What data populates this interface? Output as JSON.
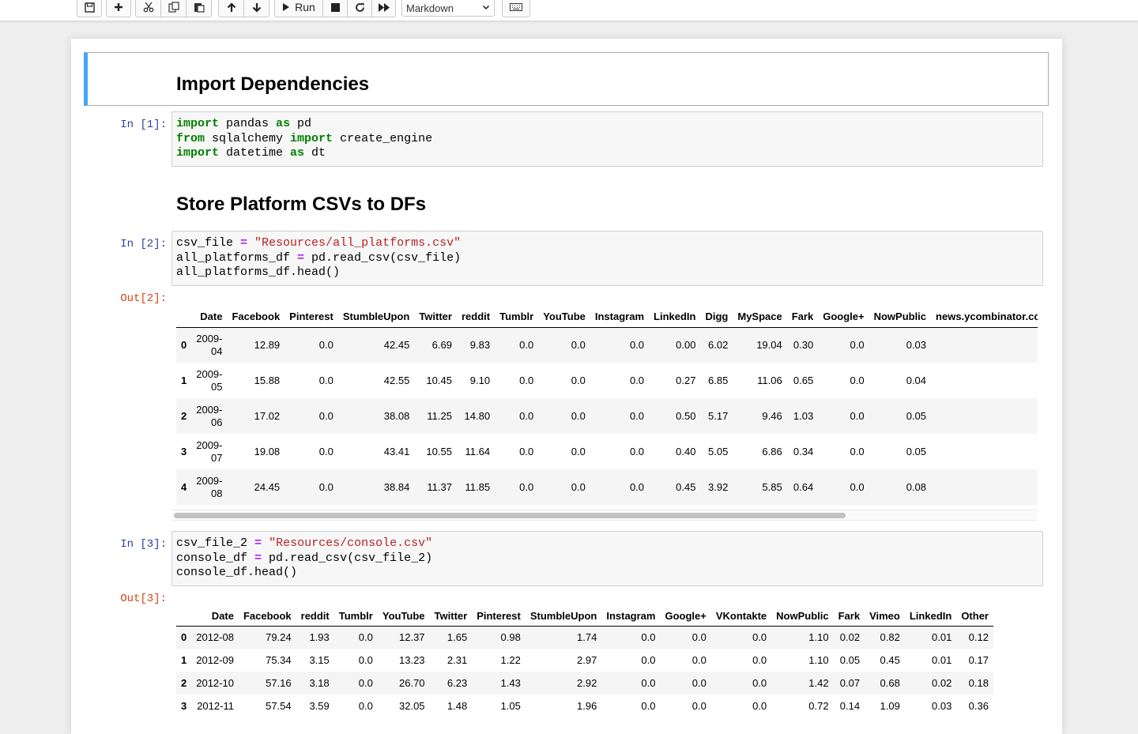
{
  "toolbar": {
    "run_label": "Run",
    "cell_type": "Markdown"
  },
  "cells": {
    "h1": "Import Dependencies",
    "in1_prompt": "In [1]:",
    "code1": [
      [
        {
          "c": "kw",
          "t": "import"
        },
        {
          "c": "",
          "t": " pandas "
        },
        {
          "c": "kw",
          "t": "as"
        },
        {
          "c": "",
          "t": " pd"
        }
      ],
      [
        {
          "c": "kw",
          "t": "from"
        },
        {
          "c": "",
          "t": " sqlalchemy "
        },
        {
          "c": "kw",
          "t": "import"
        },
        {
          "c": "",
          "t": " create_engine"
        }
      ],
      [
        {
          "c": "kw",
          "t": "import"
        },
        {
          "c": "",
          "t": " datetime "
        },
        {
          "c": "kw",
          "t": "as"
        },
        {
          "c": "",
          "t": " dt"
        }
      ]
    ],
    "h2": "Store Platform CSVs to DFs",
    "in2_prompt": "In [2]:",
    "code2": [
      [
        {
          "c": "",
          "t": "csv_file "
        },
        {
          "c": "op",
          "t": "="
        },
        {
          "c": "",
          "t": " "
        },
        {
          "c": "str",
          "t": "\"Resources/all_platforms.csv\""
        }
      ],
      [
        {
          "c": "",
          "t": "all_platforms_df "
        },
        {
          "c": "op",
          "t": "="
        },
        {
          "c": "",
          "t": " pd.read_csv(csv_file)"
        }
      ],
      [
        {
          "c": "",
          "t": "all_platforms_df.head()"
        }
      ]
    ],
    "out2_prompt": "Out[2]:",
    "in3_prompt": "In [3]:",
    "code3": [
      [
        {
          "c": "",
          "t": "csv_file_2 "
        },
        {
          "c": "op",
          "t": "="
        },
        {
          "c": "",
          "t": " "
        },
        {
          "c": "str",
          "t": "\"Resources/console.csv\""
        }
      ],
      [
        {
          "c": "",
          "t": "console_df "
        },
        {
          "c": "op",
          "t": "="
        },
        {
          "c": "",
          "t": " pd.read_csv(csv_file_2)"
        }
      ],
      [
        {
          "c": "",
          "t": "console_df.head()"
        }
      ]
    ],
    "out3_prompt": "Out[3]:"
  },
  "df1": {
    "columns": [
      "",
      "Date",
      "Facebook",
      "Pinterest",
      "StumbleUpon",
      "Twitter",
      "reddit",
      "Tumblr",
      "YouTube",
      "Instagram",
      "LinkedIn",
      "Digg",
      "MySpace",
      "Fark",
      "Google+",
      "NowPublic",
      "news.ycombinator.com"
    ],
    "rows": [
      [
        "0",
        [
          "2009-",
          "04"
        ],
        "12.89",
        "0.0",
        "42.45",
        "6.69",
        "9.83",
        "0.0",
        "0.0",
        "0.0",
        "0.00",
        "6.02",
        "19.04",
        "0.30",
        "0.0",
        "0.03",
        ""
      ],
      [
        "1",
        [
          "2009-",
          "05"
        ],
        "15.88",
        "0.0",
        "42.55",
        "10.45",
        "9.10",
        "0.0",
        "0.0",
        "0.0",
        "0.27",
        "6.85",
        "11.06",
        "0.65",
        "0.0",
        "0.04",
        ""
      ],
      [
        "2",
        [
          "2009-",
          "06"
        ],
        "17.02",
        "0.0",
        "38.08",
        "11.25",
        "14.80",
        "0.0",
        "0.0",
        "0.0",
        "0.50",
        "5.17",
        "9.46",
        "1.03",
        "0.0",
        "0.05",
        ""
      ],
      [
        "3",
        [
          "2009-",
          "07"
        ],
        "19.08",
        "0.0",
        "43.41",
        "10.55",
        "11.64",
        "0.0",
        "0.0",
        "0.0",
        "0.40",
        "5.05",
        "6.86",
        "0.34",
        "0.0",
        "0.05",
        ""
      ],
      [
        "4",
        [
          "2009-",
          "08"
        ],
        "24.45",
        "0.0",
        "38.84",
        "11.37",
        "11.85",
        "0.0",
        "0.0",
        "0.0",
        "0.45",
        "3.92",
        "5.85",
        "0.64",
        "0.0",
        "0.08",
        ""
      ]
    ]
  },
  "df2": {
    "columns": [
      "",
      "Date",
      "Facebook",
      "reddit",
      "Tumblr",
      "YouTube",
      "Twitter",
      "Pinterest",
      "StumbleUpon",
      "Instagram",
      "Google+",
      "VKontakte",
      "NowPublic",
      "Fark",
      "Vimeo",
      "LinkedIn",
      "Other"
    ],
    "rows": [
      [
        "0",
        "2012-08",
        "79.24",
        "1.93",
        "0.0",
        "12.37",
        "1.65",
        "0.98",
        "1.74",
        "0.0",
        "0.0",
        "0.0",
        "1.10",
        "0.02",
        "0.82",
        "0.01",
        "0.12"
      ],
      [
        "1",
        "2012-09",
        "75.34",
        "3.15",
        "0.0",
        "13.23",
        "2.31",
        "1.22",
        "2.97",
        "0.0",
        "0.0",
        "0.0",
        "1.10",
        "0.05",
        "0.45",
        "0.01",
        "0.17"
      ],
      [
        "2",
        "2012-10",
        "57.16",
        "3.18",
        "0.0",
        "26.70",
        "6.23",
        "1.43",
        "2.92",
        "0.0",
        "0.0",
        "0.0",
        "1.42",
        "0.07",
        "0.68",
        "0.02",
        "0.18"
      ],
      [
        "3",
        "2012-11",
        "57.54",
        "3.59",
        "0.0",
        "32.05",
        "1.48",
        "1.05",
        "1.96",
        "0.0",
        "0.0",
        "0.0",
        "0.72",
        "0.14",
        "1.09",
        "0.03",
        "0.36"
      ]
    ]
  }
}
